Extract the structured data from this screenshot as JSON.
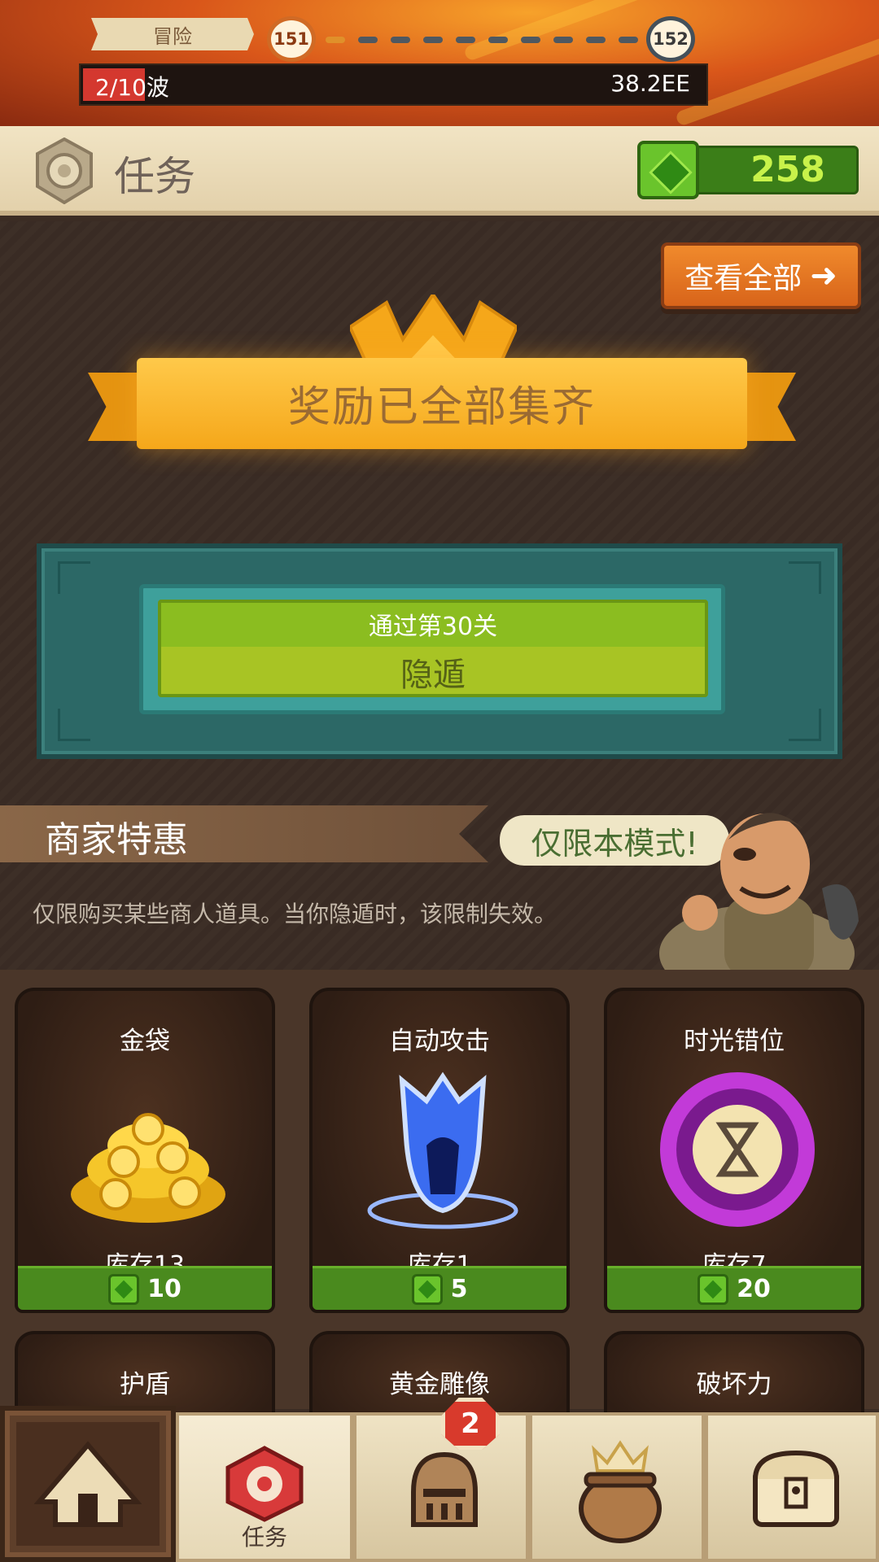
{
  "top_bar": {
    "mode_label": "冒险",
    "current_level": "151",
    "next_level": "152",
    "wave_text": "2/10波",
    "wave_progress": 0.2,
    "power": "38.2EE"
  },
  "header": {
    "title": "任务",
    "gem_count": "258"
  },
  "quests": {
    "view_all_label": "查看全部",
    "banner_text": "奖励已全部集齐",
    "quest_condition": "通过第30关",
    "quest_title": "隐遁"
  },
  "merchant": {
    "title": "商家特惠",
    "bubble": "仅限本模式!",
    "description": "仅限购买某些商人道具。当你隐遁时，该限制失效。"
  },
  "shop_items": [
    {
      "name": "金袋",
      "stock": "库存13",
      "price": "10",
      "icon": "gold-coins-icon"
    },
    {
      "name": "自动攻击",
      "stock": "库存1",
      "price": "5",
      "icon": "auto-attack-icon"
    },
    {
      "name": "时光错位",
      "stock": "库存7",
      "price": "20",
      "icon": "time-warp-icon"
    },
    {
      "name": "护盾",
      "icon": "shield-icon"
    },
    {
      "name": "黄金雕像",
      "icon": "golden-statue-icon"
    },
    {
      "name": "破坏力",
      "icon": "destruction-icon"
    }
  ],
  "nav": {
    "items": [
      {
        "icon": "camp-tent-icon"
      },
      {
        "icon": "quest-seal-icon",
        "label": "任务"
      },
      {
        "icon": "knight-helmet-icon",
        "badge": "2"
      },
      {
        "icon": "cauldron-icon"
      },
      {
        "icon": "treasure-chest-icon"
      }
    ]
  },
  "colors": {
    "accent_orange": "#e8721e",
    "gem_green": "#4a8a1e",
    "quest_panel_teal": "#2c6866",
    "ribbon_gold": "#f5a71a"
  }
}
